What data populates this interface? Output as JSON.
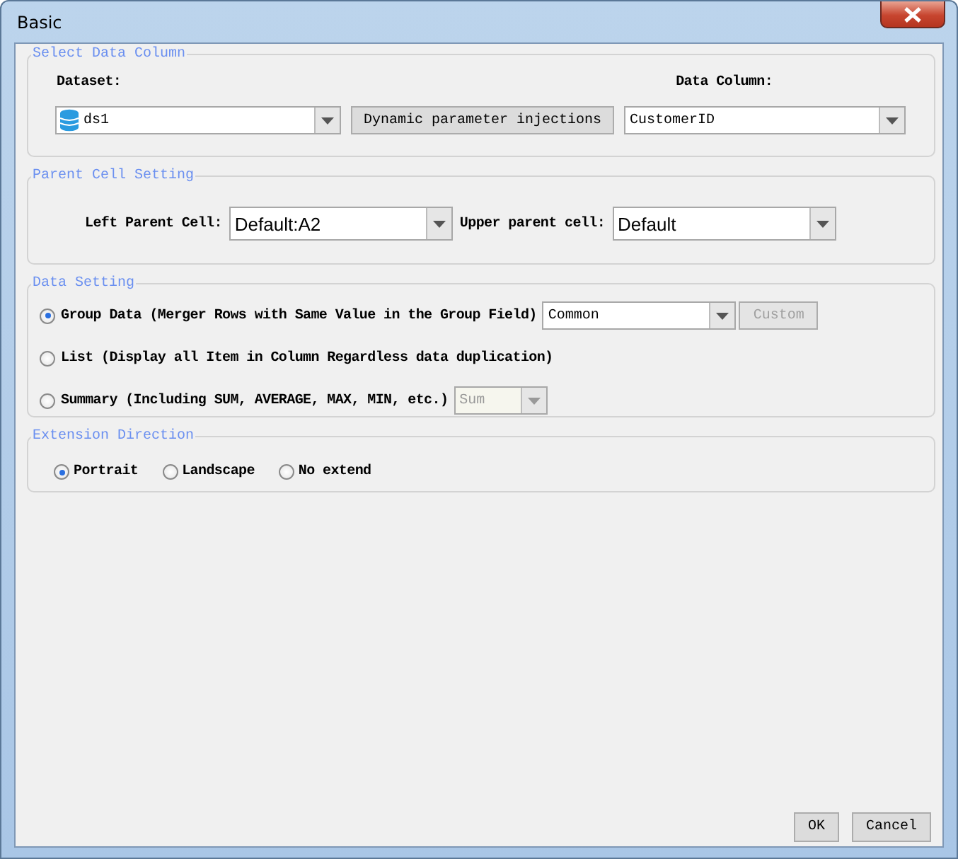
{
  "window": {
    "title": "Basic"
  },
  "select_data_column": {
    "legend": "Select Data Column",
    "dataset_label": "Dataset:",
    "dataset_value": "ds1",
    "injection_button": "Dynamic parameter injections",
    "data_column_label": "Data Column:",
    "data_column_value": "CustomerID"
  },
  "parent_cell_setting": {
    "legend": "Parent Cell Setting",
    "left_label": "Left Parent Cell:",
    "left_value": "Default:A2",
    "upper_label": "Upper parent cell:",
    "upper_value": "Default"
  },
  "data_setting": {
    "legend": "Data Setting",
    "options": [
      {
        "kind": "group",
        "label": "Group Data (Merger Rows with Same Value in the Group Field)",
        "selected": true,
        "combo_value": "Common",
        "combo_disabled": false,
        "button": "Custom",
        "button_disabled": true
      },
      {
        "kind": "list",
        "label": "List (Display all Item in Column Regardless data duplication)",
        "selected": false
      },
      {
        "kind": "summary",
        "label": "Summary (Including SUM, AVERAGE, MAX, MIN, etc.)",
        "selected": false,
        "combo_value": "Sum",
        "combo_disabled": true
      }
    ]
  },
  "extension_direction": {
    "legend": "Extension Direction",
    "options": [
      {
        "label": "Portrait",
        "selected": true
      },
      {
        "label": "Landscape",
        "selected": false
      },
      {
        "label": "No extend",
        "selected": false
      }
    ]
  },
  "buttons": [
    {
      "label": "OK"
    },
    {
      "label": "Cancel"
    }
  ]
}
